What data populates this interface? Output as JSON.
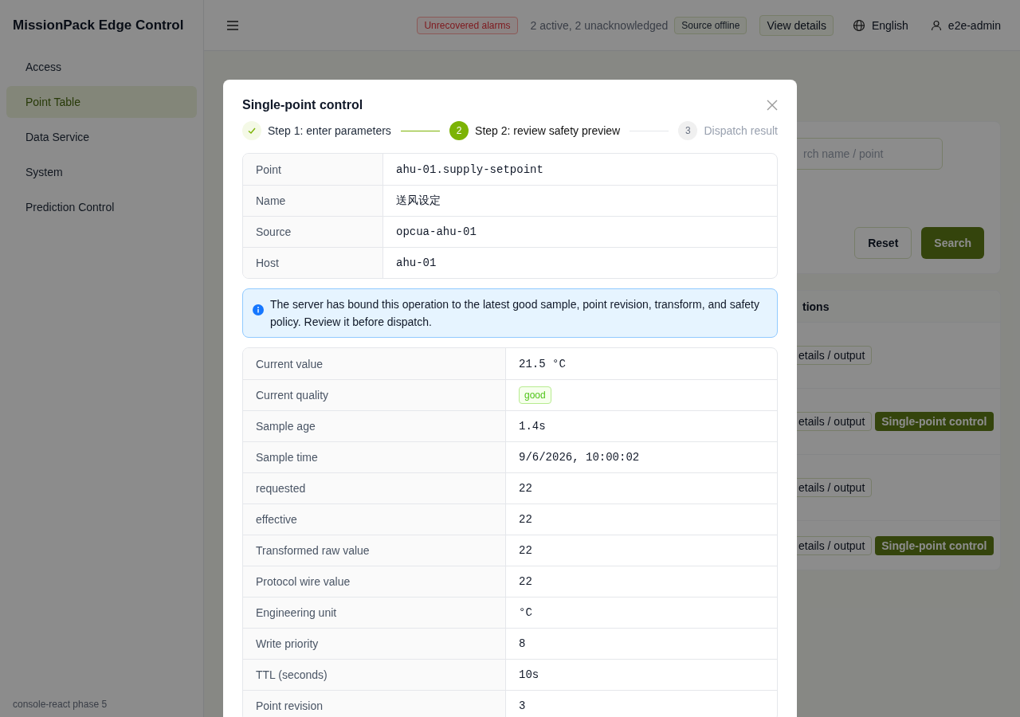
{
  "app": {
    "title": "MissionPack Edge Control",
    "footer": "console-react phase 5"
  },
  "sidebar": {
    "items": [
      {
        "label": "Access",
        "selected": false
      },
      {
        "label": "Point Table",
        "selected": true
      },
      {
        "label": "Data Service",
        "selected": false
      },
      {
        "label": "System",
        "selected": false
      },
      {
        "label": "Prediction Control",
        "selected": false
      }
    ]
  },
  "header": {
    "alarm_tag": "Unrecovered alarms",
    "alarm_summary": "2 active, 2 unacknowledged",
    "source_tag": "Source offline",
    "details_button": "View details",
    "language": "English",
    "user": "e2e-admin"
  },
  "page": {
    "search": {
      "placeholder": "rch name / point"
    },
    "buttons": {
      "reset": "Reset",
      "search": "Search"
    },
    "table": {
      "column": "tions",
      "rows": [
        {
          "actions": [
            "etails / output"
          ]
        },
        {
          "actions": [
            "etails / output",
            "Single-point control"
          ]
        },
        {
          "actions": [
            "etails / output"
          ]
        },
        {
          "actions": [
            "etails / output",
            "Single-point control"
          ]
        }
      ]
    }
  },
  "modal": {
    "title": "Single-point control",
    "steps": [
      {
        "completed": true,
        "selected": false,
        "label": "Step 1: enter parameters"
      },
      {
        "completed": false,
        "selected": true,
        "number": "2",
        "label": "Step 2: review safety preview"
      },
      {
        "completed": false,
        "selected": false,
        "number": "3",
        "label": "Dispatch result"
      }
    ],
    "point_info": [
      {
        "label": "Point",
        "value": "ahu-01.supply-setpoint"
      },
      {
        "label": "Name",
        "value": "送风设定"
      },
      {
        "label": "Source",
        "value": "opcua-ahu-01"
      },
      {
        "label": "Host",
        "value": "ahu-01"
      }
    ],
    "alert": "The server has bound this operation to the latest good sample, point revision, transform, and safety policy. Review it before dispatch.",
    "preview": [
      {
        "kind": "text",
        "label": "Current value",
        "value": "21.5 °C"
      },
      {
        "kind": "tag",
        "label": "Current quality",
        "value": "good"
      },
      {
        "kind": "text",
        "label": "Sample age",
        "value": "1.4s"
      },
      {
        "kind": "text",
        "label": "Sample time",
        "value": "9/6/2026, 10:00:02"
      },
      {
        "kind": "text",
        "label": "requested",
        "value": "22"
      },
      {
        "kind": "text",
        "label": "effective",
        "value": "22"
      },
      {
        "kind": "text",
        "label": "Transformed raw value",
        "value": "22"
      },
      {
        "kind": "text",
        "label": "Protocol wire value",
        "value": "22"
      },
      {
        "kind": "text",
        "label": "Engineering unit",
        "value": "°C"
      },
      {
        "kind": "text",
        "label": "Write priority",
        "value": "8"
      },
      {
        "kind": "text",
        "label": "TTL (seconds)",
        "value": "10s"
      },
      {
        "kind": "text",
        "label": "Point revision",
        "value": "3"
      }
    ]
  }
}
